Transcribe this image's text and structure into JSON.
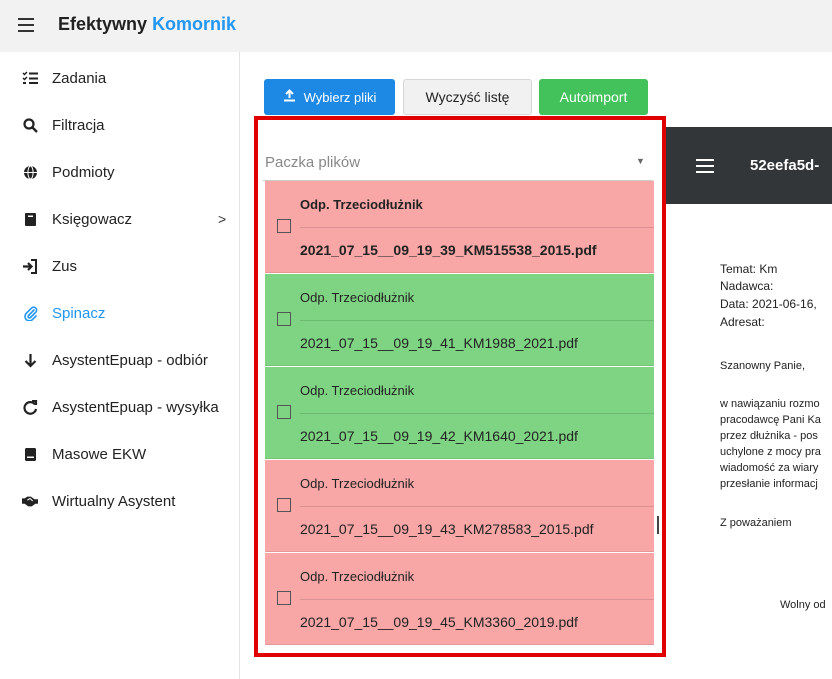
{
  "app": {
    "title_part1": "Efektywny",
    "title_part2": "Komornik"
  },
  "sidebar": {
    "items": [
      {
        "label": "Zadania",
        "icon": "list-check-icon"
      },
      {
        "label": "Filtracja",
        "icon": "search-icon"
      },
      {
        "label": "Podmioty",
        "icon": "globe-icon"
      },
      {
        "label": "Księgowacz",
        "icon": "book-icon",
        "chevron": ">"
      },
      {
        "label": "Zus",
        "icon": "sign-in-icon"
      },
      {
        "label": "Spinacz",
        "icon": "paperclip-icon",
        "active": true
      },
      {
        "label": "AsystentEpuap - odbiór",
        "icon": "arrow-down-icon"
      },
      {
        "label": "AsystentEpuap - wysyłka",
        "icon": "redo-icon"
      },
      {
        "label": "Masowe EKW",
        "icon": "document-icon"
      },
      {
        "label": "Wirtualny Asystent",
        "icon": "handshake-icon"
      }
    ]
  },
  "toolbar": {
    "choose_files": "Wybierz pliki",
    "clear_list": "Wyczyść listę",
    "autoimport": "Autoimport"
  },
  "package_select": {
    "placeholder": "Paczka plików"
  },
  "files": [
    {
      "title": "Odp. Trzeciodłużnik",
      "filename": "2021_07_15__09_19_39_KM515538_2015.pdf",
      "status": "red",
      "bold": true
    },
    {
      "title": "Odp. Trzeciodłużnik",
      "filename": "2021_07_15__09_19_41_KM1988_2021.pdf",
      "status": "green",
      "bold": false
    },
    {
      "title": "Odp. Trzeciodłużnik",
      "filename": "2021_07_15__09_19_42_KM1640_2021.pdf",
      "status": "green",
      "bold": false
    },
    {
      "title": "Odp. Trzeciodłużnik",
      "filename": "2021_07_15__09_19_43_KM278583_2015.pdf",
      "status": "red",
      "bold": false
    },
    {
      "title": "Odp. Trzeciodłużnik",
      "filename": "2021_07_15__09_19_45_KM3360_2019.pdf",
      "status": "red",
      "bold": false
    }
  ],
  "viewer": {
    "doc_title": "52eefa5d-",
    "lines": {
      "temat": "Temat: Km",
      "nadawca": "Nadawca:",
      "data": "Data: 2021-06-16,",
      "adresat": "Adresat:",
      "greeting": "Szanowny Panie,",
      "p1": "w nawiązaniu rozmo",
      "p2": "pracodawcę Pani Ka",
      "p3": "przez dłużnika - pos",
      "p4": "uchylone z mocy pra",
      "p5": "wiadomość za wiary",
      "p6": "przesłanie informacj",
      "closing": "Z poważaniem",
      "sign": "Wolny od"
    }
  },
  "colors": {
    "accent": "#2196f3",
    "row_red": "#f8a6a6",
    "row_green": "#7fd483",
    "frame": "#e00000"
  }
}
